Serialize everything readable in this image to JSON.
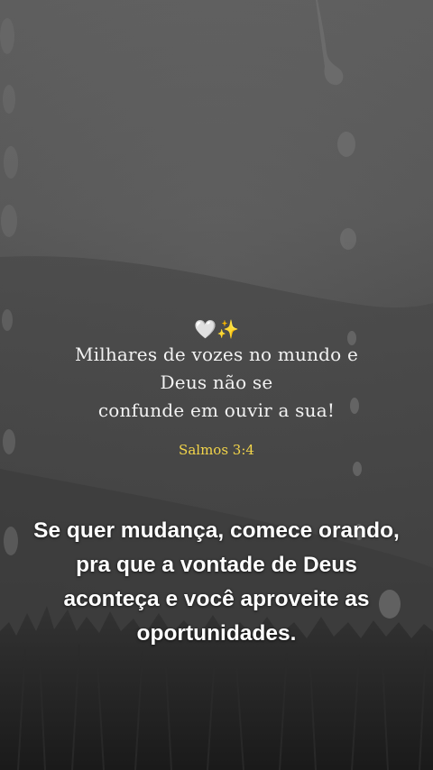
{
  "quote": {
    "emoji_heart": "🤍",
    "emoji_sparkles": "✨",
    "lines": [
      "Milhares de vozes no mundo e",
      "Deus não se",
      "confunde em ouvir a sua!"
    ],
    "reference": "Salmos 3:4"
  },
  "caption": {
    "lines": [
      "Se quer mudança, comece orando,",
      "pra que a vontade de Deus",
      "aconteça e você aproveite as",
      "oportunidades."
    ]
  },
  "colors": {
    "reference": "#f3d54a",
    "caption": "#ffffff",
    "quote": "#f2f2f2"
  }
}
